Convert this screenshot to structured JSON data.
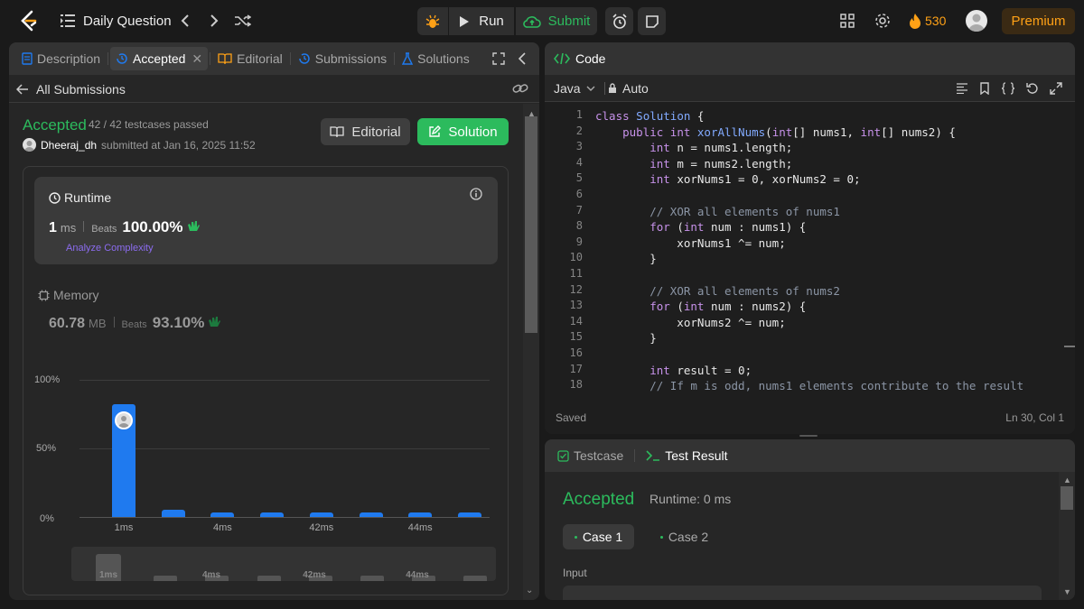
{
  "topbar": {
    "title": "Daily Question",
    "run_label": "Run",
    "submit_label": "Submit",
    "streak_count": "530",
    "premium_label": "Premium"
  },
  "left": {
    "tabs": [
      {
        "label": "Description"
      },
      {
        "label": "Accepted"
      },
      {
        "label": "Editorial"
      },
      {
        "label": "Submissions"
      },
      {
        "label": "Solutions"
      }
    ],
    "all_submissions": "All Submissions",
    "status": "Accepted",
    "testcases": "42 / 42 testcases passed",
    "username": "Dheeraj_dh",
    "submitted_at": "submitted at Jan 16, 2025 11:52",
    "editorial_btn": "Editorial",
    "solution_btn": "Solution",
    "runtime": {
      "title": "Runtime",
      "value": "1",
      "unit": "ms",
      "beats_label": "Beats",
      "beats": "100.00%",
      "analyze": "Analyze Complexity"
    },
    "memory": {
      "title": "Memory",
      "value": "60.78",
      "unit": "MB",
      "beats_label": "Beats",
      "beats": "93.10%"
    }
  },
  "chart_data": {
    "type": "bar",
    "y_ticks": [
      "100%",
      "50%",
      "0%"
    ],
    "x_ticks": [
      "1ms",
      "4ms",
      "42ms",
      "44ms"
    ],
    "values_percent": [
      82,
      5,
      3,
      3,
      3,
      3,
      3,
      3
    ],
    "mini_ticks": [
      "1ms",
      "4ms",
      "42ms",
      "44ms"
    ]
  },
  "code": {
    "header": "Code",
    "language": "Java",
    "mode": "Auto",
    "saved": "Saved",
    "cursor": "Ln 30, Col 1",
    "lines": [
      "class Solution {",
      "    public int xorAllNums(int[] nums1, int[] nums2) {",
      "        int n = nums1.length;",
      "        int m = nums2.length;",
      "        int xorNums1 = 0, xorNums2 = 0;",
      "",
      "        // XOR all elements of nums1",
      "        for (int num : nums1) {",
      "            xorNums1 ^= num;",
      "        }",
      "",
      "        // XOR all elements of nums2",
      "        for (int num : nums2) {",
      "            xorNums2 ^= num;",
      "        }",
      "",
      "        int result = 0;",
      "        // If m is odd, nums1 elements contribute to the result"
    ]
  },
  "testpanel": {
    "testcase_tab": "Testcase",
    "result_tab": "Test Result",
    "status": "Accepted",
    "runtime": "Runtime: 0 ms",
    "case1": "Case 1",
    "case2": "Case 2",
    "input_label": "Input"
  },
  "colors": {
    "accent_green": "#2cbb5d",
    "orange": "#ffa116",
    "bar_blue": "#1f7aef"
  }
}
